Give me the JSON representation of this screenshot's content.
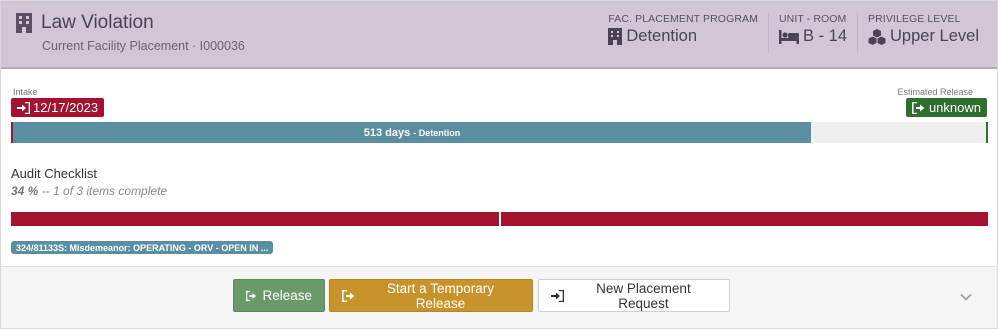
{
  "header": {
    "title": "Law Violation",
    "subtitle": "Current Facility Placement · I000036",
    "program": {
      "label": "FAC. PLACEMENT PROGRAM",
      "value": "Detention"
    },
    "unit": {
      "label": "UNIT - ROOM",
      "value": "B - 14"
    },
    "privilege": {
      "label": "PRIVILEGE LEVEL",
      "value": "Upper Level"
    }
  },
  "timeline": {
    "start_label": "Intake",
    "start_value": "12/17/2023",
    "end_label": "Estimated Release",
    "end_value": "unknown",
    "days_text": "513 days",
    "program_text": "- Detention",
    "progress_fraction": 0.82
  },
  "audit": {
    "title": "Audit Checklist",
    "percent": "34 %",
    "detail": "-- 1 of 3 items complete",
    "segments": 2
  },
  "charge_badge": "324/81133S: Misdemeanor: OPERATING - ORV - OPEN IN ...",
  "buttons": {
    "release": "Release",
    "temporary_release": "Start a Temporary Release",
    "new_placement": "New Placement Request"
  },
  "colors": {
    "header_bg": "#d2c6d6",
    "intake": "#a3122e",
    "release": "#2e6f2e",
    "progress": "#5a8fa1",
    "release_btn": "#6a9a6a",
    "temp_btn": "#c9932c"
  },
  "icons": {
    "header": "building-icon",
    "program": "building-icon",
    "unit": "bed-icon",
    "privilege": "cubes-icon",
    "intake": "sign-in-icon",
    "release": "sign-out-icon",
    "chevron": "chevron-down-icon"
  }
}
